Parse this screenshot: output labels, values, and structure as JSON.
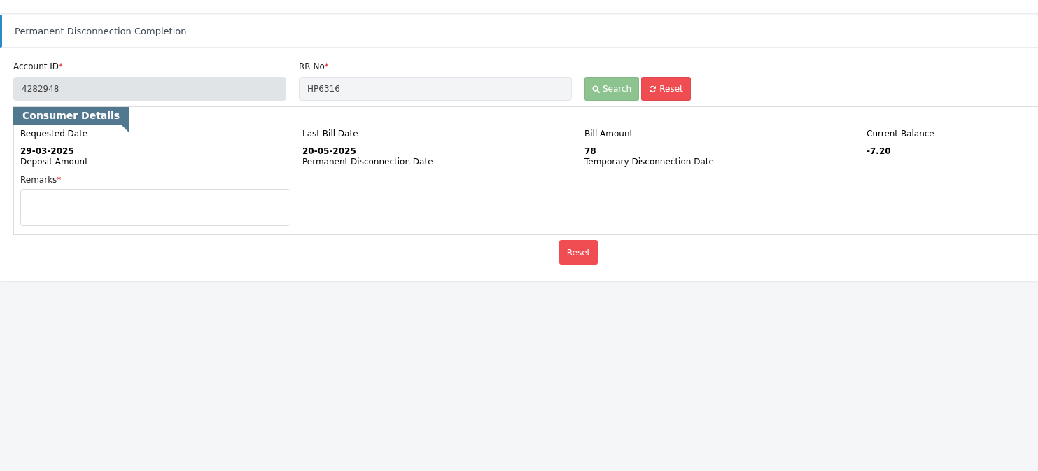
{
  "panel": {
    "title": "Permanent Disconnection Completion"
  },
  "fields": [
    {
      "label": "Account ID",
      "required_mark": "*",
      "value": "4282948",
      "disabled": true
    },
    {
      "label": "RR No",
      "required_mark": "*",
      "value": "HP6316",
      "disabled": false
    }
  ],
  "search_buttons": [
    {
      "label": "Search",
      "kind": "search"
    },
    {
      "label": "Reset",
      "kind": "reset"
    }
  ],
  "consumer_details": {
    "title": "Consumer Details",
    "items": [
      {
        "label": "Requested Date",
        "value": "29-03-2025"
      },
      {
        "label": "Last Bill Date",
        "value": "20-05-2025"
      },
      {
        "label": "Bill Amount",
        "value": "78"
      },
      {
        "label": "Current Balance",
        "value": "-7.20"
      },
      {
        "label": "Deposit Amount"
      },
      {
        "label": "Permanent Disconnection Date"
      },
      {
        "label": "Temporary Disconnection Date"
      }
    ],
    "remarks": {
      "label": "Remarks",
      "required_mark": "*"
    }
  },
  "footer_button": {
    "label": "Reset"
  }
}
